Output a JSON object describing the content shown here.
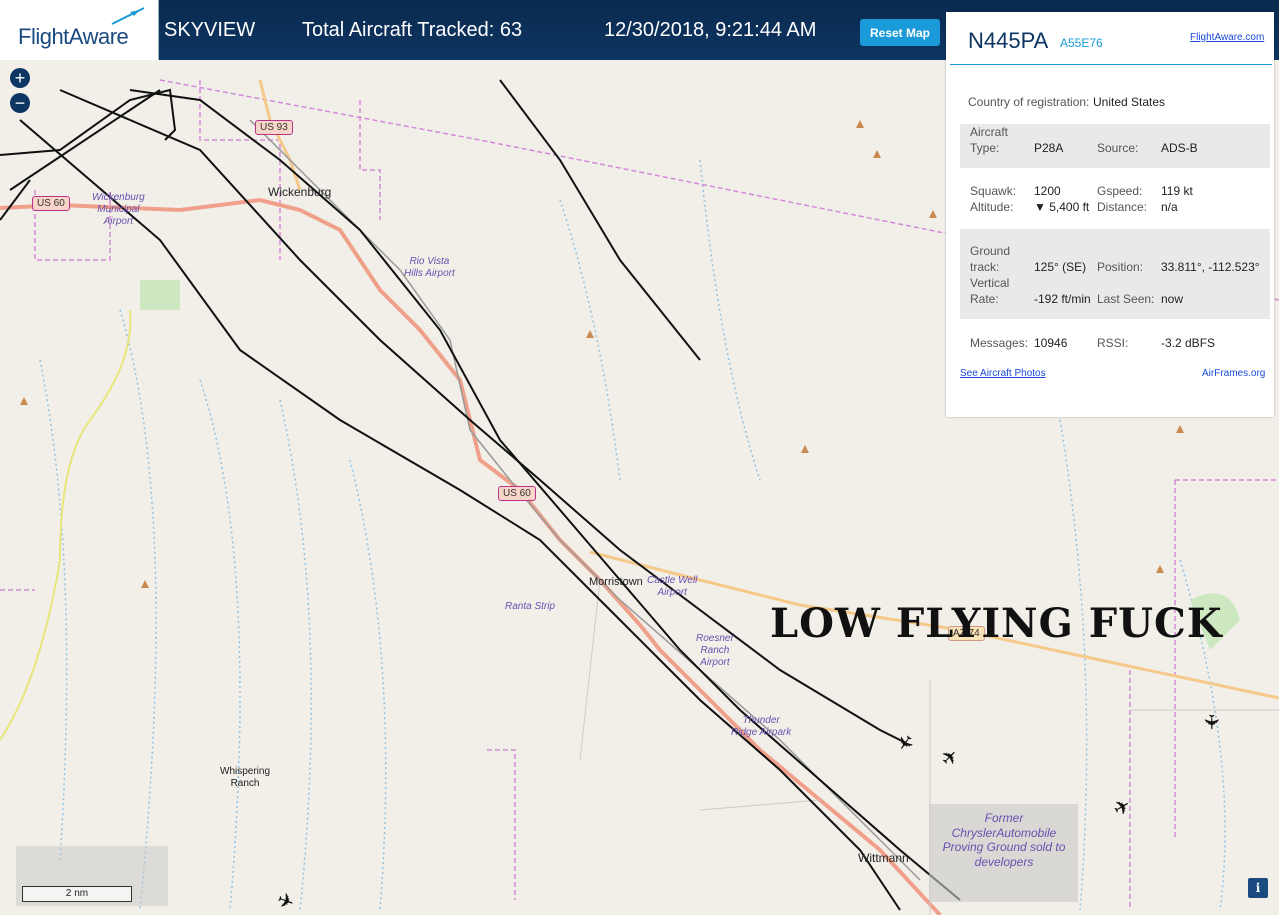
{
  "header": {
    "logo": "FlightAware",
    "title": "SKYVIEW",
    "aircraft_count": "Total Aircraft Tracked: 63",
    "datetime": "12/30/2018, 9:21:44 AM",
    "reset_label": "Reset Map"
  },
  "zoom": {
    "in": "+",
    "out": "−"
  },
  "map": {
    "places": [
      {
        "name": "Wickenburg",
        "id": "wickenburg"
      },
      {
        "name": "Morristown",
        "id": "morristown"
      },
      {
        "name": "Wittmann",
        "id": "wittmann"
      },
      {
        "name": "Whispering\nRanch",
        "id": "whispering-ranch"
      }
    ],
    "airports": [
      "Wickenburg\nMunicipal\nAirport",
      "Rio Vista\nHills Airport",
      "Ranta Strip",
      "Castle Well\nAirport",
      "Roesner\nRanch\nAirport",
      "Thunder\nRidge Airpark"
    ],
    "roads": [
      "US 93",
      "US 60",
      "US 60",
      "AZ 74"
    ],
    "proving_ground": "Former ChryslerAutomobile Proving Ground sold to developers",
    "scale": "2 nm",
    "info": "i"
  },
  "overlay_text": "LOW FLYING FUCK",
  "panel": {
    "registration": "N445PA",
    "hex": "A55E76",
    "fa_link": "FlightAware.com",
    "country_label": "Country of registration:",
    "country": "United States",
    "type_label": "Aircraft Type:",
    "type": "P28A",
    "source_label": "Source:",
    "source": "ADS-B",
    "squawk_label": "Squawk:",
    "squawk": "1200",
    "gspeed_label": "Gspeed:",
    "gspeed": "119 kt",
    "altitude_label": "Altitude:",
    "altitude": "▼ 5,400 ft",
    "distance_label": "Distance:",
    "distance": "n/a",
    "track_label": "Ground track:",
    "track": "125° (SE)",
    "position_label": "Position:",
    "position": "33.811°, -112.523°",
    "vrate_label": "Vertical Rate:",
    "vrate": "-192 ft/min",
    "lastseen_label": "Last Seen:",
    "lastseen": "now",
    "messages_label": "Messages:",
    "messages": "10946",
    "rssi_label": "RSSI:",
    "rssi": "-3.2 dBFS",
    "photos_link": "See Aircraft Photos",
    "airframes_link": "AirFrames.org"
  },
  "colors": {
    "header": "#0d3562",
    "accent": "#1a9ad8",
    "track": "#111111",
    "highway": "#f0a08a"
  }
}
